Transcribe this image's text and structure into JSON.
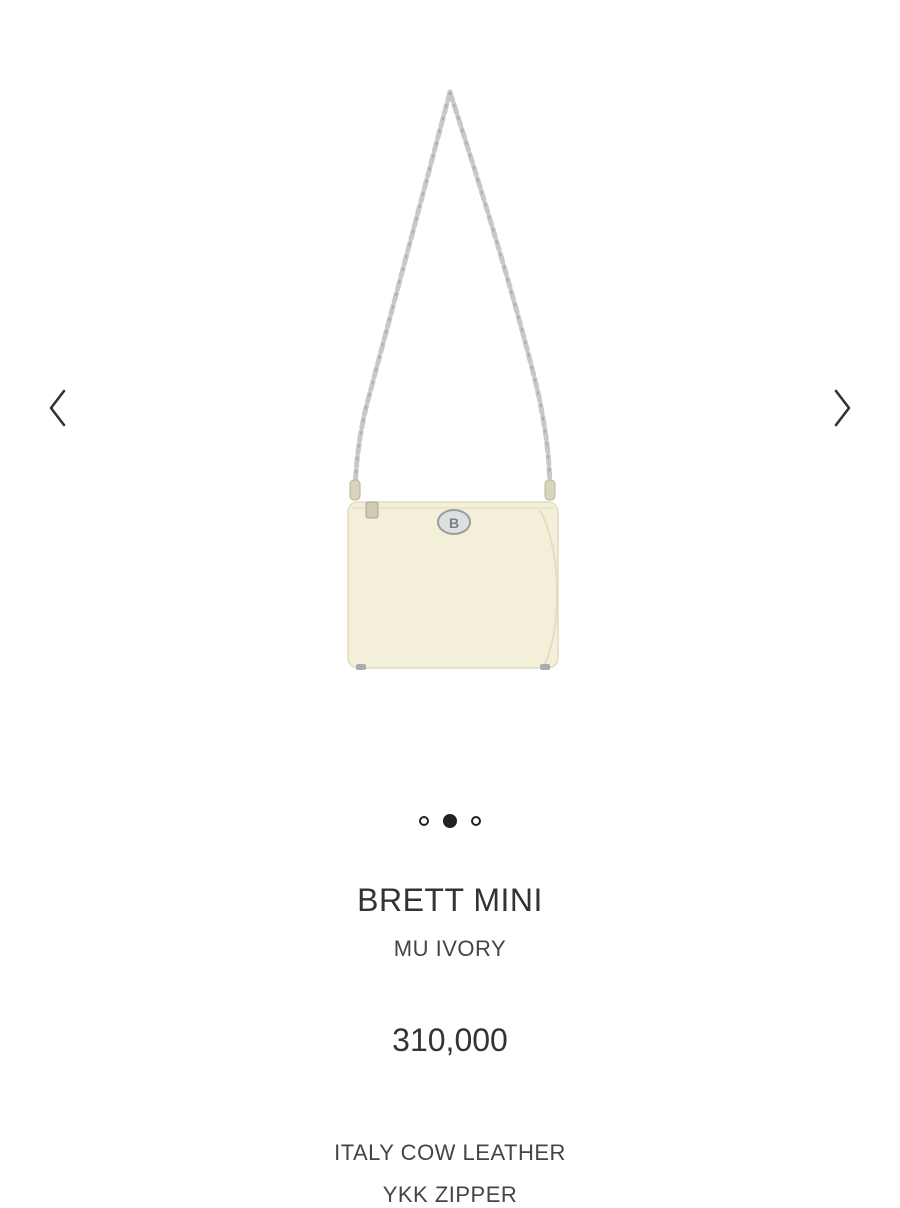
{
  "gallery": {
    "slide_count": 3,
    "active_index": 1,
    "product_color": "#f4efd8",
    "chain_color": "#c6c9cc"
  },
  "icons": {
    "prev": "chevron-left-icon",
    "next": "chevron-right-icon"
  },
  "product": {
    "name": "BRETT MINI",
    "color_name": "MU IVORY",
    "price": "310,000",
    "specs": [
      "ITALY COW LEATHER",
      "YKK ZIPPER"
    ]
  }
}
